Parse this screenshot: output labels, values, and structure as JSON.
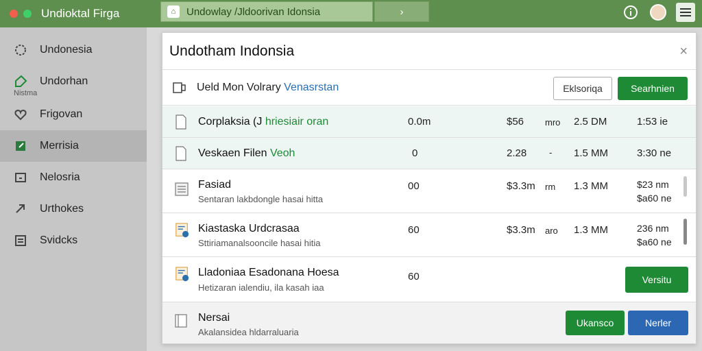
{
  "titlebar": {
    "app_title": "Undioktal Firga",
    "address": "Undowlay /Jldoorivan Idonsia",
    "forward": "›"
  },
  "sidebar": {
    "items": [
      {
        "label": "Undonesia",
        "icon": "gear-icon"
      },
      {
        "label": "Undorhan",
        "sub": "Nistma",
        "icon": "tag-icon"
      },
      {
        "label": "Frigovan",
        "icon": "heart-icon"
      },
      {
        "label": "Merrisia",
        "icon": "edit-icon"
      },
      {
        "label": "Nelosria",
        "icon": "window-icon"
      },
      {
        "label": "Urthokes",
        "icon": "link-icon"
      },
      {
        "label": "Svidcks",
        "icon": "list-icon"
      }
    ]
  },
  "dialog": {
    "title": "Undotham Indonsia",
    "close": "×",
    "toolbar": {
      "label": "Ueld Mon Volrary",
      "label_blue": "Venasrstan",
      "outline_button": "Eklsoriqa",
      "green_button": "Searhnien"
    },
    "rows": [
      {
        "name": "Corplaksia (J",
        "name_green": "hriesiair oran",
        "c1": "0.0m",
        "c2": "$56",
        "c3": "mro",
        "c4": "2.5 DM",
        "c5": "1:53 ie"
      },
      {
        "name": "Veskaen Filen",
        "name_green": "Veoh",
        "c1": "0",
        "c2": "2.28",
        "c3": "-",
        "c4": "1.5 MM",
        "c5": "3:30 ne"
      },
      {
        "name": "Fasiad",
        "sub": "Sentaran lakbdongle hasai hitta",
        "c1": "00",
        "c2": "$3.3m",
        "c3": "rm",
        "c4": "1.3 MM",
        "c5": "$23 nm",
        "c5b": "$a60 ne"
      },
      {
        "name": "Kiastaska Urdcrasaa",
        "sub": "Sttiriamanalsooncile hasai hitia",
        "c1": "60",
        "c2": "$3.3m",
        "c3": "aro",
        "c4": "1.3 MM",
        "c5": "236 nm",
        "c5b": "$a60 ne"
      },
      {
        "name": "Lladoniaa Esadonana Hoesa",
        "sub": "Hetizaran ialendiu, ila kasah iaa",
        "c1": "60",
        "button": "Versitu"
      },
      {
        "name": "Nersai",
        "sub": "Akalansidea hldarraluaria",
        "button_green": "Ukansco",
        "button_blue": "Nerler"
      }
    ]
  }
}
